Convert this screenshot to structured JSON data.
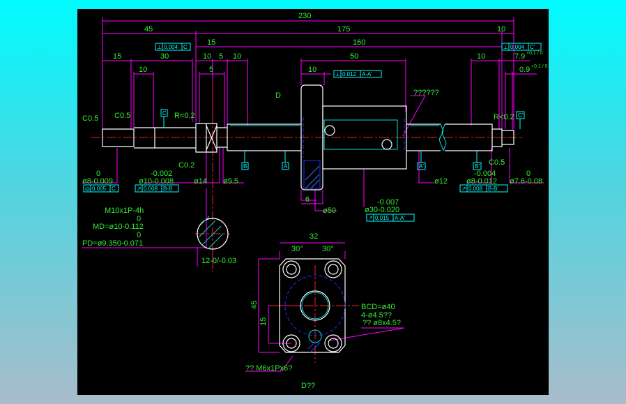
{
  "dims": {
    "d230": "230",
    "d45": "45",
    "d175": "175",
    "d10a": "10",
    "d15a": "15",
    "d160": "160",
    "d15b": "15",
    "d30": "30",
    "d10b": "10",
    "d5a": "5",
    "d10c": "10",
    "d50": "50",
    "d10d": "10",
    "d79": "7.9",
    "d79tol": "+0.1 / 0",
    "d10e": "10",
    "d5b": "5",
    "d10f": "10",
    "d09": "0.9",
    "d09tol": "+0.1 / 0",
    "d6": "6",
    "d32": "32",
    "a30l": "30°",
    "a30r": "30°",
    "d45v": "45",
    "d15v": "15"
  },
  "tolerance_frames": [
    {
      "sym": "⊥",
      "val": "0.004",
      "ref": "C"
    },
    {
      "sym": "⊥",
      "val": "0.012",
      "ref": "A-A'"
    },
    {
      "sym": "⊥",
      "val": "0.004",
      "ref": "C'"
    },
    {
      "sym": "◎",
      "val": "0.005",
      "ref": "C"
    },
    {
      "sym": "↗",
      "val": "0.008",
      "ref": "B-B"
    },
    {
      "sym": "↗",
      "val": "0.008",
      "ref": "B-B'"
    },
    {
      "sym": "↗",
      "val": "0.015",
      "ref": "A-A'"
    }
  ],
  "datums": {
    "c": "C",
    "b": "B",
    "a": "A",
    "ap": "A'",
    "bp": "B'",
    "cp": "C'"
  },
  "notes": {
    "c05a": "C0.5",
    "c05b": "C0.5",
    "r02a": "R<0.2",
    "d": "D",
    "unk": "??????",
    "r02b": "R<0.2",
    "c02": "C0.2",
    "c05c": "C0.5",
    "d8u": "0",
    "d8": "ø8-0.009",
    "d10u": "-0.002",
    "d10": "ø10-0.008",
    "d14": "ø14",
    "d95": "ø9.5",
    "d50": "ø50",
    "d12": "ø12",
    "d8bu": "-0.004",
    "d8b": "ø8-0.012",
    "d76u": "0",
    "d76": "ø7.6-0.08",
    "d30u": "-0.007",
    "d30": "ø30-0.020",
    "thread": "M10x1P-4h",
    "mdu": "0",
    "md": "MD=ø10-0.112",
    "pdu": "0",
    "pd": "PD=ø9.350-0.071",
    "key": "12-0/-0.03",
    "bcd": "BCD=ø40",
    "holes": "4-ø4.5??",
    "cb": "?? ø8x4.5?",
    "tap": "?? M6x1Px6?",
    "view": "D??"
  }
}
